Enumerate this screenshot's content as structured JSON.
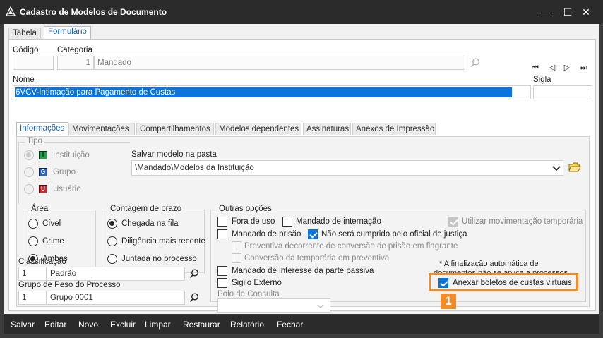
{
  "window": {
    "title": "Cadastro de Modelos de Documento",
    "minimize": "—",
    "maximize": "☐",
    "close": "✕"
  },
  "outer_tabs": [
    {
      "label": "Tabela",
      "active": false
    },
    {
      "label": "Formulário",
      "active": true
    }
  ],
  "header": {
    "codigo_label": "Código",
    "codigo_value": "",
    "categoria_label": "Categoria",
    "categoria_code": "1",
    "categoria_name": "Mandado",
    "nav": [
      "⏮",
      "◁",
      "▷",
      "⏭"
    ],
    "nome_label": "Nome",
    "nome_value": "6VCV-Intimação para Pagamento de Custas",
    "sigla_label": "Sigla",
    "sigla_value": ""
  },
  "inner_tabs": [
    {
      "label": "Informações",
      "active": true
    },
    {
      "label": "Movimentações",
      "active": false
    },
    {
      "label": "Compartilhamentos",
      "active": false
    },
    {
      "label": "Modelos dependentes",
      "active": false
    },
    {
      "label": "Assinaturas",
      "active": false
    },
    {
      "label": "Anexos de Impressão",
      "active": false
    }
  ],
  "tipo": {
    "title": "Tipo",
    "options": [
      {
        "label": "Instituição",
        "icon": "I",
        "color": "#1fa34a",
        "selected": true
      },
      {
        "label": "Grupo",
        "icon": "G",
        "color": "#2a64c8",
        "selected": false
      },
      {
        "label": "Usuário",
        "icon": "U",
        "color": "#d8232a",
        "selected": false
      }
    ]
  },
  "pasta": {
    "label": "Salvar modelo na pasta",
    "value": "\\Mandado\\Modelos da Instituição"
  },
  "area": {
    "title": "Área",
    "options": [
      {
        "label": "Cível",
        "selected": false
      },
      {
        "label": "Crime",
        "selected": false
      },
      {
        "label": "Ambas",
        "selected": true
      }
    ]
  },
  "contagem": {
    "title": "Contagem de prazo",
    "options": [
      {
        "label": "Chegada na fila",
        "selected": true
      },
      {
        "label": "Diligência mais recente",
        "selected": false
      },
      {
        "label": "Juntada no processo",
        "selected": false
      }
    ]
  },
  "outras": {
    "title": "Outras opções",
    "fora_de_uso": "Fora de uso",
    "mandado_internacao": "Mandado de internação",
    "utilizar_mov": "Utilizar movimentação temporária",
    "mandado_prisao": "Mandado de prisão",
    "nao_sera_cumprido": "Não será cumprido pelo oficial de justiça",
    "preventiva_decorrente": "Preventiva decorrente de conversão de prisão em flagrante",
    "conversao_temporaria": "Conversão da temporária em preventiva",
    "mandado_interesse": "Mandado de interesse da parte passiva",
    "sigilo_externo": "Sigilo Externo",
    "polo_label": "Polo de Consulta",
    "nota_line1": "* A finalização automática de",
    "nota_line2": "documentos não se aplica a processos",
    "anexar_boletos": "Anexar boletos de custas virtuais"
  },
  "classificacao": {
    "label": "Classificação",
    "code": "1",
    "name": "Padrão"
  },
  "grupo_peso": {
    "label": "Grupo de Peso do Processo",
    "code": "1",
    "name": "Grupo 0001"
  },
  "callout_number": "1",
  "bottom_buttons": [
    "Salvar",
    "Editar",
    "Novo",
    "Excluir",
    "Limpar",
    "Restaurar",
    "Relatório",
    "Fechar"
  ],
  "colors": {
    "accent": "#0a74da",
    "highlight": "#f28c28",
    "titlebar": "#2b2b2b"
  }
}
